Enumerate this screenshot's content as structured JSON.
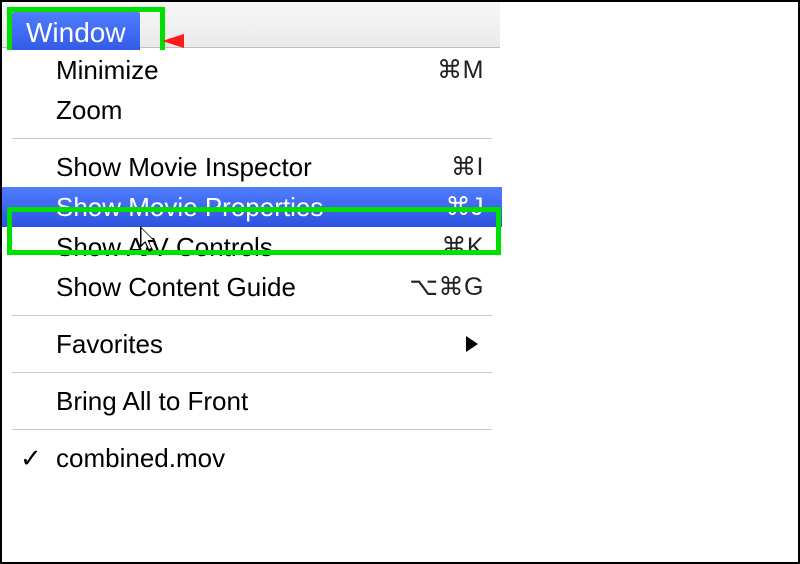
{
  "menubar": {
    "menu_title": "Window"
  },
  "menu": {
    "minimize": {
      "label": "Minimize",
      "shortcut": "⌘M"
    },
    "zoom": {
      "label": "Zoom",
      "shortcut": ""
    },
    "inspector": {
      "label": "Show Movie Inspector",
      "shortcut": "⌘I"
    },
    "properties": {
      "label": "Show Movie Properties",
      "shortcut": "⌘J"
    },
    "av_controls": {
      "label": "Show A/V Controls",
      "shortcut": "⌘K"
    },
    "content_guide": {
      "label": "Show Content Guide",
      "shortcut": "⌥⌘G"
    },
    "favorites": {
      "label": "Favorites",
      "shortcut": ""
    },
    "bring_front": {
      "label": "Bring All to Front",
      "shortcut": ""
    },
    "window_combined": {
      "label": "combined.mov",
      "shortcut": ""
    }
  }
}
